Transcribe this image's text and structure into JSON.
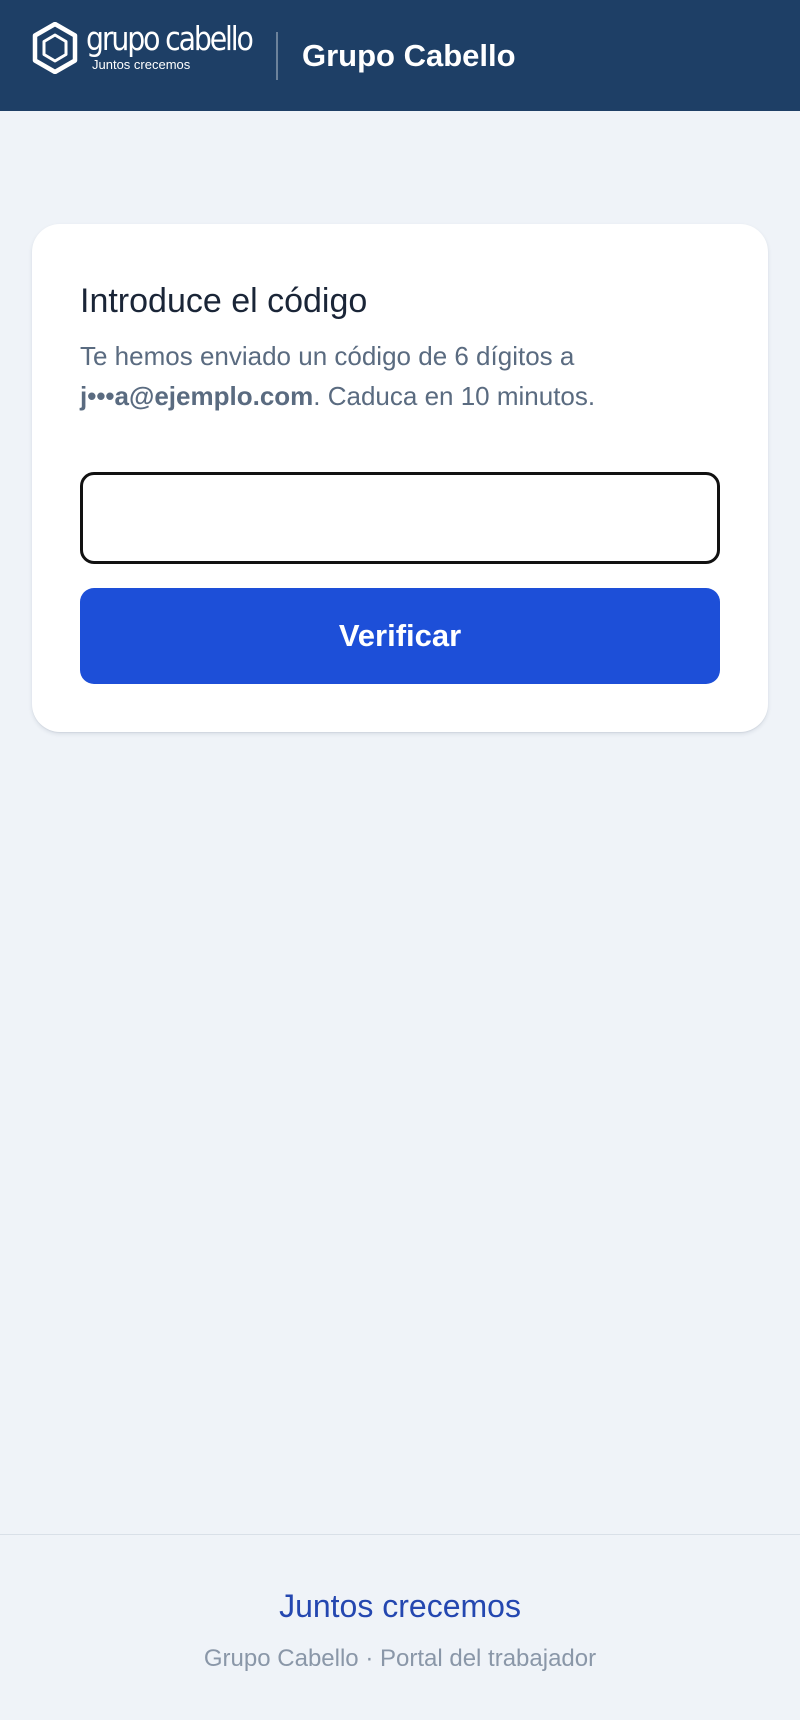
{
  "header": {
    "logo": {
      "wordmark": "grupo cabello",
      "tagline": "Juntos crecemos",
      "icon": "hexagon-logo-icon"
    },
    "title": "Grupo Cabello"
  },
  "card": {
    "title": "Introduce el código",
    "description_prefix": "Te hemos enviado un código de 6 dígitos a ",
    "masked_email": "j•••a@ejemplo.com",
    "description_suffix": ". Caduca en 10 minutos.",
    "code_input": {
      "value": "",
      "placeholder": ""
    },
    "verify_label": "Verificar"
  },
  "footer": {
    "slogan": "Juntos crecemos",
    "subtitle": "Grupo Cabello · Portal del trabajador"
  },
  "colors": {
    "header_bg": "#1e3f66",
    "page_bg": "#eff3f8",
    "primary_button": "#1d4fd8",
    "slogan": "#2447b0"
  }
}
